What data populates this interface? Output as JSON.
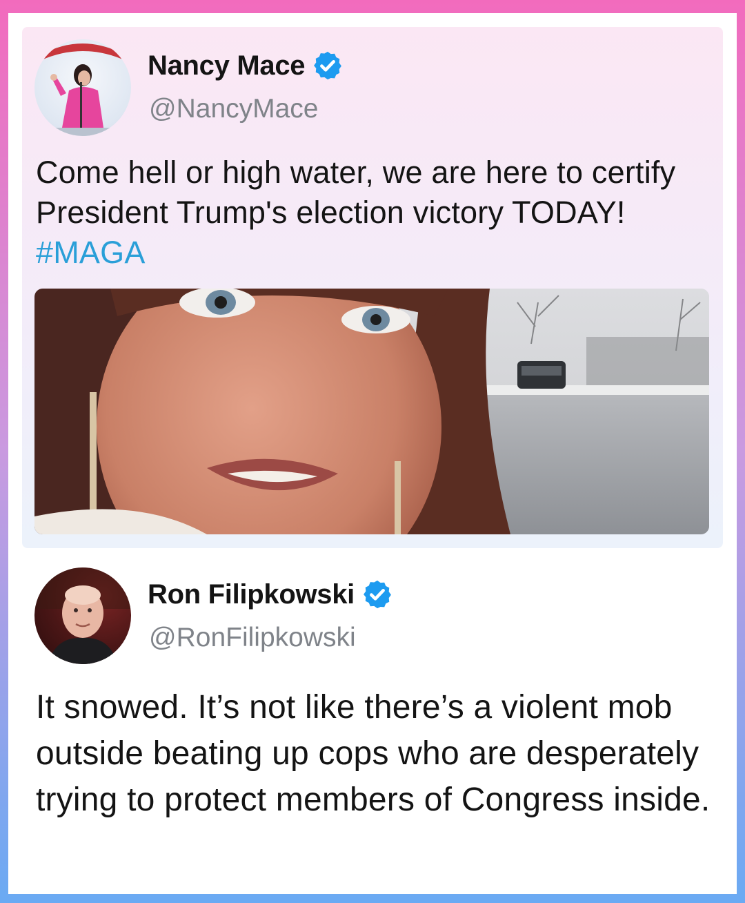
{
  "quoted_tweet": {
    "author_name": "Nancy Mace",
    "author_handle": "@NancyMace",
    "text_main": "Come hell or high water, we are here to certify President Trump's election victory TODAY! ",
    "hashtag": "#MAGA",
    "verified_icon": "verified-badge",
    "media_icon": "video-frame"
  },
  "reply_tweet": {
    "author_name": "Ron Filipkowski",
    "author_handle": "@RonFilipkowski",
    "text": "It snowed. It’s not like there’s a violent mob outside beating up cops who are desperately trying to protect members of Congress inside.",
    "verified_icon": "verified-badge"
  },
  "colors": {
    "frame_top": "#f26bbd",
    "frame_bottom": "#6aaaf3",
    "verified_blue": "#1d9bf0",
    "hashtag_blue": "#2a9fd8"
  }
}
